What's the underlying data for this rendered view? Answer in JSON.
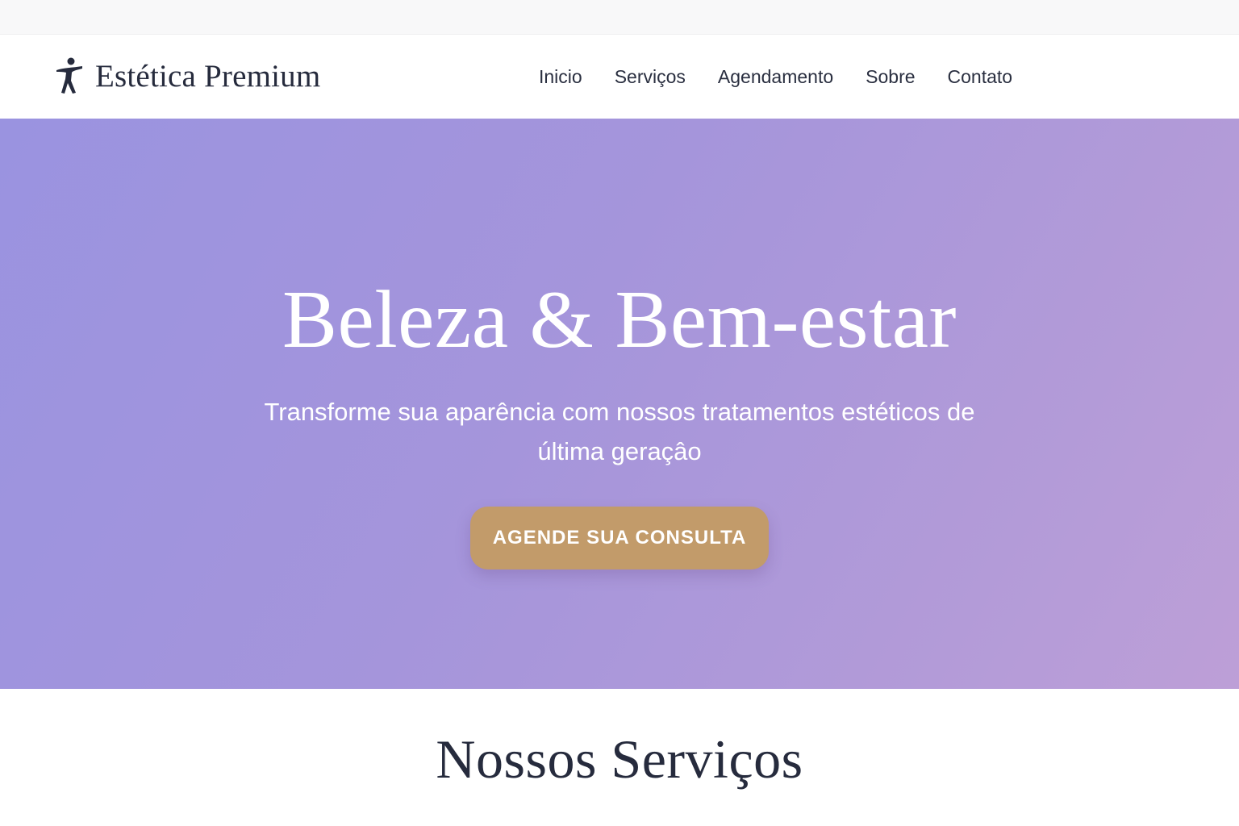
{
  "brand": {
    "name": "Estética Premium",
    "icon": "dancer-figure-icon",
    "color": "#262b3d"
  },
  "nav": {
    "items": [
      {
        "label": "Inicio"
      },
      {
        "label": "Serviços"
      },
      {
        "label": "Agendamento"
      },
      {
        "label": "Sobre"
      },
      {
        "label": "Contato"
      }
    ]
  },
  "hero": {
    "title": "Beleza & Bem-estar",
    "subtitle": "Transforme sua aparência com nossos tratamentos estéticos de última geraçâo",
    "cta_label": "AGENDE SUA CONSULTA",
    "gradient_start": "#9a93e0",
    "gradient_end": "#bd9fd7",
    "cta_color": "#c29b6a"
  },
  "services": {
    "title": "Nossos Serviços"
  }
}
